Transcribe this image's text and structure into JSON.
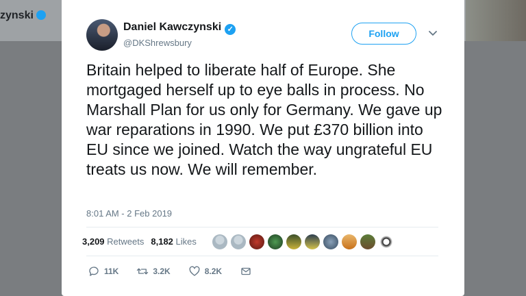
{
  "background": {
    "profile_name": "zynski"
  },
  "tweet": {
    "author": {
      "name": "Daniel Kawczynski",
      "handle": "@DKShrewsbury",
      "verified_icon": "verified-badge-icon"
    },
    "follow_label": "Follow",
    "text": "Britain helped to liberate half of Europe. She mortgaged herself up to eye balls in process. No Marshall Plan for us only for Germany. We gave up war reparations in 1990. We put £370 billion into EU since we joined. Watch the way ungrateful EU treats us now. We will remember.",
    "timestamp": "8:01 AM - 2 Feb 2019",
    "stats": {
      "retweets_count": "3,209",
      "retweets_label": "Retweets",
      "likes_count": "8,182",
      "likes_label": "Likes"
    },
    "actions": {
      "replies": "11K",
      "retweets": "3.2K",
      "likes": "8.2K"
    }
  },
  "colors": {
    "accent": "#1da1f2",
    "muted": "#657786",
    "text": "#14171a"
  }
}
